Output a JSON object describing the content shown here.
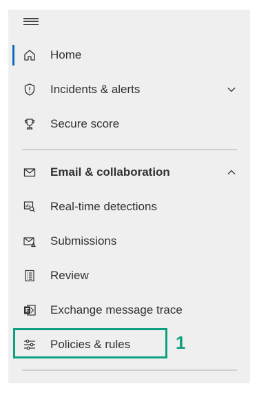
{
  "nav": {
    "items": [
      {
        "label": "Home",
        "icon": "home-icon",
        "active": true
      },
      {
        "label": "Incidents & alerts",
        "icon": "shield-icon",
        "expandable": true,
        "expanded": false
      },
      {
        "label": "Secure score",
        "icon": "trophy-icon"
      },
      {
        "label": "Email & collaboration",
        "icon": "mail-icon",
        "expandable": true,
        "expanded": true,
        "section_header": true
      },
      {
        "label": "Real-time detections",
        "icon": "detections-icon"
      },
      {
        "label": "Submissions",
        "icon": "submissions-icon"
      },
      {
        "label": "Review",
        "icon": "review-icon"
      },
      {
        "label": "Exchange message trace",
        "icon": "exchange-icon"
      },
      {
        "label": "Policies & rules",
        "icon": "sliders-icon",
        "highlighted": true
      }
    ]
  },
  "callout": {
    "number": "1",
    "color": "#0da07f"
  },
  "colors": {
    "panel_bg": "#efefef",
    "active_bar": "#0f6cbd",
    "text": "#323130"
  }
}
